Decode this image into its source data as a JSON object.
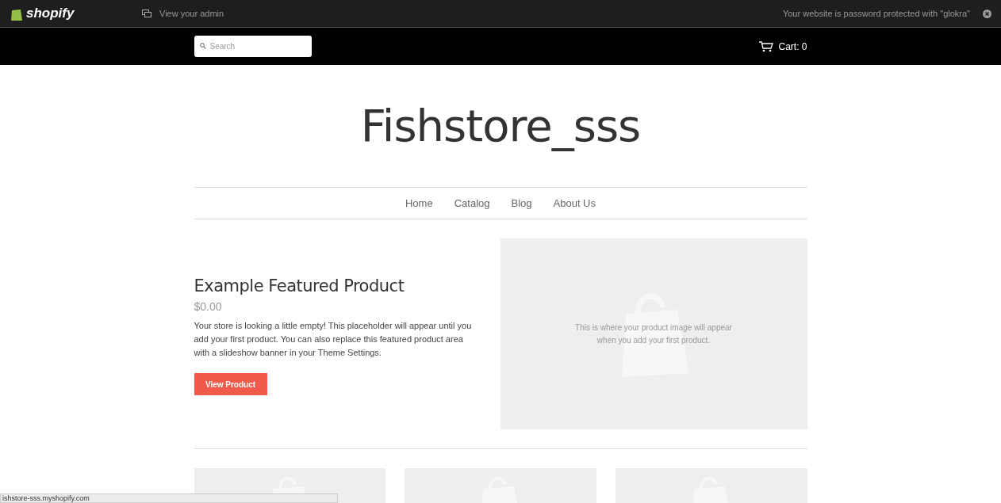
{
  "admin_bar": {
    "logo": "shopify",
    "admin_link": "View your admin",
    "notice": "Your website is password protected with \"glokra\""
  },
  "header": {
    "search": {
      "placeholder": "Search"
    },
    "cart": "Cart: 0"
  },
  "store_title": "Fishstore_sss",
  "nav": [
    "Home",
    "Catalog",
    "Blog",
    "About Us"
  ],
  "featured": {
    "title": "Example Featured Product",
    "price": "$0.00",
    "description": "Your store is looking a little empty! This placeholder will appear until you add your first product. You can also replace this featured product area with a slideshow banner in your Theme Settings.",
    "button": "View Product",
    "image_text": "This is where your product image will appear when you add your first product."
  },
  "products": [
    {
      "kind": "placeholder"
    },
    {
      "kind": "placeholder"
    },
    {
      "kind": "placeholder"
    }
  ],
  "status_bar": "ishstore-sss.myshopify.com"
}
